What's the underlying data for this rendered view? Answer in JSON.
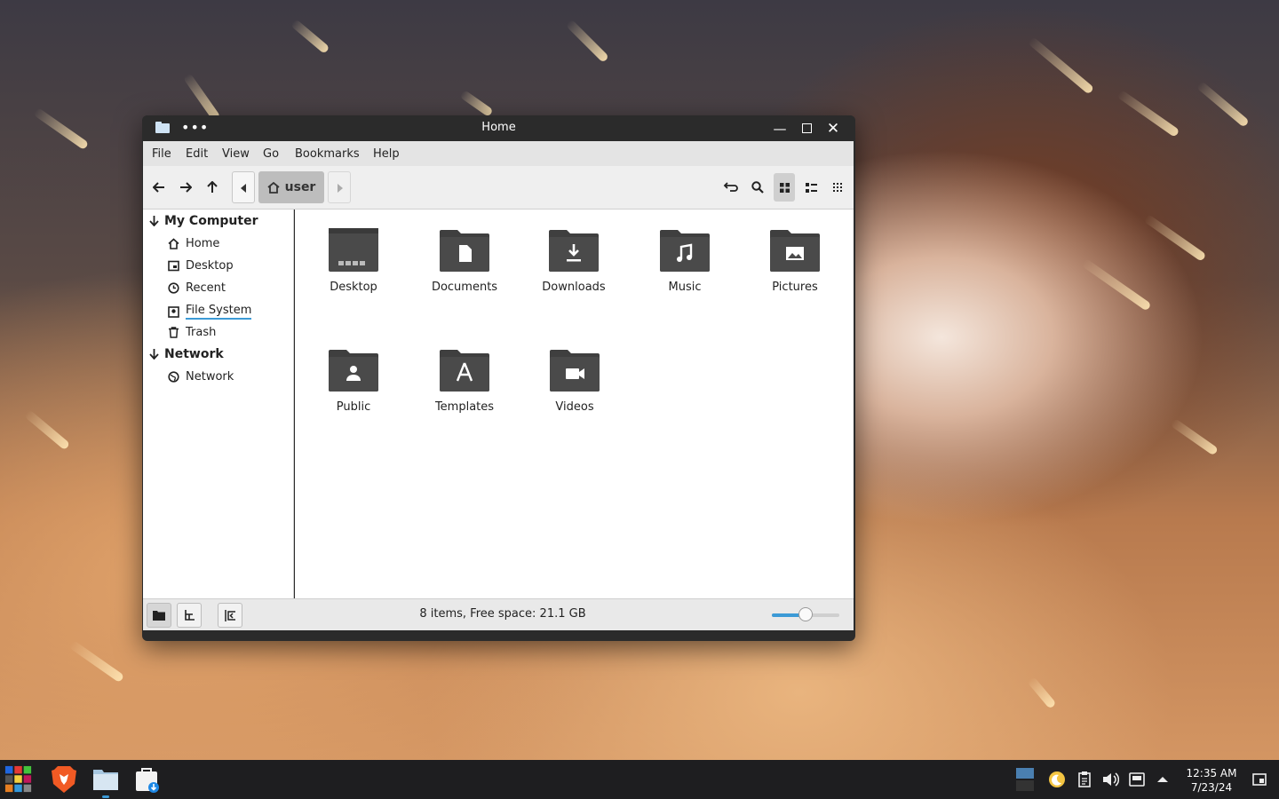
{
  "window": {
    "title": "Home"
  },
  "menu": [
    "File",
    "Edit",
    "View",
    "Go",
    "Bookmarks",
    "Help"
  ],
  "breadcrumb": {
    "current": "user"
  },
  "sidebar": {
    "sections": [
      {
        "label": "My Computer",
        "items": [
          "Home",
          "Desktop",
          "Recent",
          "File System",
          "Trash"
        ]
      },
      {
        "label": "Network",
        "items": [
          "Network"
        ]
      }
    ]
  },
  "files": [
    "Desktop",
    "Documents",
    "Downloads",
    "Music",
    "Pictures",
    "Public",
    "Templates",
    "Videos"
  ],
  "status": {
    "text": "8 items, Free space: 21.1 GB",
    "zoom_level": 0.5
  },
  "taskbar": {
    "time": "12:35 AM",
    "date": "7/23/24"
  },
  "colors": {
    "folder": "#3f3f3f",
    "accent": "#3c9ad6"
  }
}
